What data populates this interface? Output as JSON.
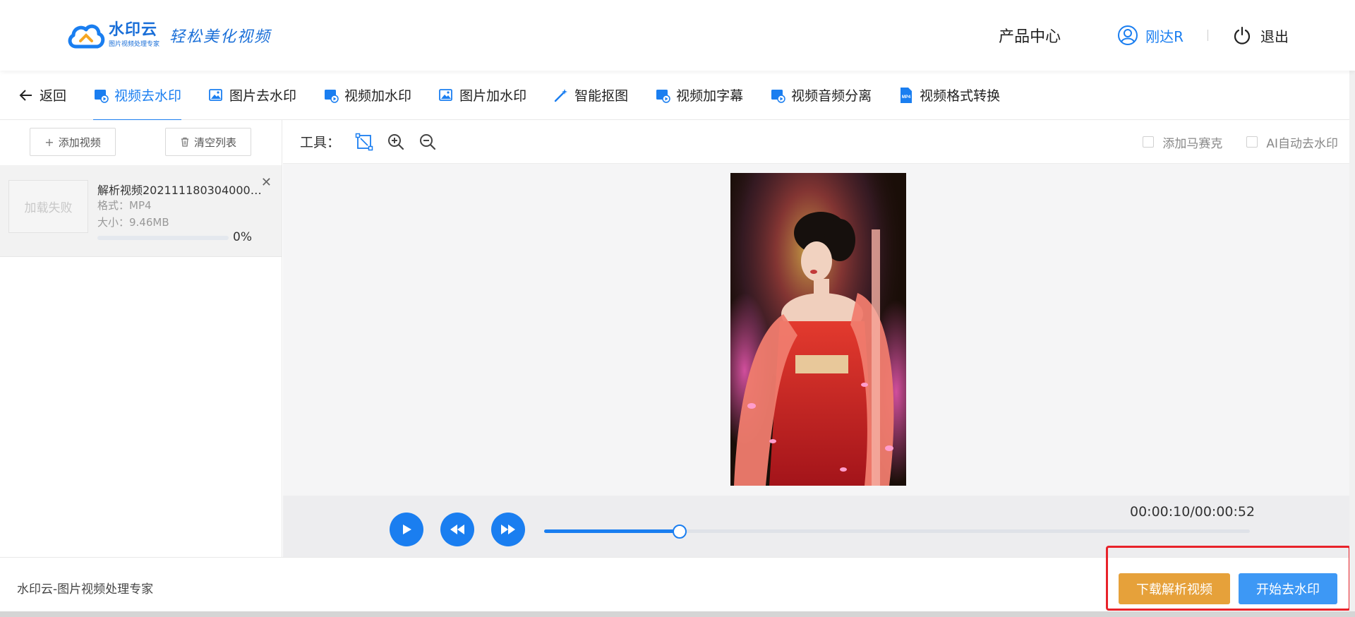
{
  "header": {
    "logo_name": "水印云",
    "logo_sub": "图片视频处理专家",
    "slogan": "轻松美化视频",
    "product_center": "产品中心",
    "username": "刚达R",
    "logout": "退出"
  },
  "nav": {
    "back": "返回",
    "tabs": [
      {
        "label": "视频去水印",
        "icon": "video-icon",
        "active": true
      },
      {
        "label": "图片去水印",
        "icon": "image-icon",
        "active": false
      },
      {
        "label": "视频加水印",
        "icon": "video-icon",
        "active": false
      },
      {
        "label": "图片加水印",
        "icon": "image-icon",
        "active": false
      },
      {
        "label": "智能抠图",
        "icon": "magic-wand-icon",
        "active": false
      },
      {
        "label": "视频加字幕",
        "icon": "video-icon",
        "active": false
      },
      {
        "label": "视频音频分离",
        "icon": "video-icon",
        "active": false
      },
      {
        "label": "视频格式转换",
        "icon": "mp4-file-icon",
        "active": false
      }
    ]
  },
  "sidebar": {
    "add_video": "添加视频",
    "clear_list": "清空列表",
    "files": [
      {
        "thumb_text": "加载失败",
        "name": "解析视频20211118030400023...",
        "format": "格式：MP4",
        "size": "大小：9.46MB",
        "progress": 0,
        "progress_label": "0%"
      }
    ]
  },
  "tools": {
    "label": "工具：",
    "add_mosaic": "添加马赛克",
    "ai_auto_remove": "AI自动去水印"
  },
  "player": {
    "current_time": "00:00:10",
    "total_time": "00:00:52",
    "time_display": "00:00:10/00:00:52",
    "progress_fraction": 0.1923
  },
  "footer": {
    "text": "水印云-图片视频处理专家",
    "download_button": "下载解析视频",
    "start_button": "开始去水印"
  },
  "colors": {
    "accent": "#1a7ef0",
    "download": "#e6a13a",
    "start": "#3d98f5",
    "highlight": "#e8222a"
  }
}
